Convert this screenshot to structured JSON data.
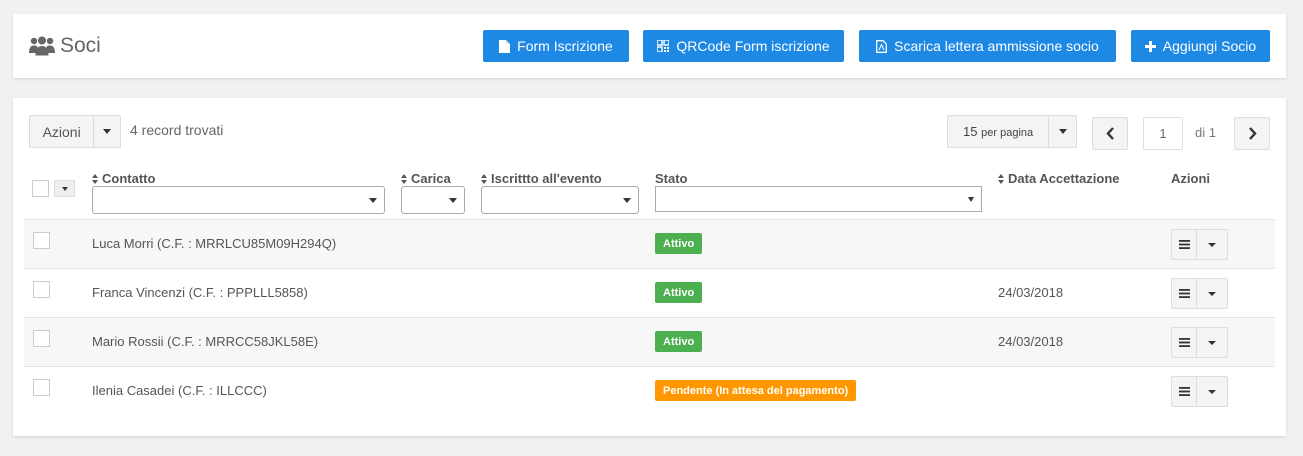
{
  "header": {
    "title": "Soci",
    "title_icon": "users-icon",
    "buttons": [
      {
        "label": "Form Iscrizione",
        "icon": "file-icon"
      },
      {
        "label": "QRCode Form iscrizione",
        "icon": "qrcode-icon"
      },
      {
        "label": "Scarica lettera ammissione socio",
        "icon": "pdf-icon"
      },
      {
        "label": "Aggiungi Socio",
        "icon": "plus-icon"
      }
    ],
    "accent_color": "#1e88e5"
  },
  "toolbar": {
    "actions_label": "Azioni",
    "record_count": "4 record trovati",
    "per_page_value": "15",
    "per_page_suffix": "per pagina",
    "current_page": "1",
    "page_of": "di 1"
  },
  "table": {
    "columns": [
      "Contatto",
      "Carica",
      "Iscrittto all'evento",
      "Stato",
      "Data Accettazione",
      "Azioni"
    ],
    "rows": [
      {
        "name": "Luca Morri (C.F. : MRRLCU85M09H294Q)",
        "status": "Attivo",
        "status_color": "#4caf50",
        "date": ""
      },
      {
        "name": "Franca Vincenzi (C.F. : PPPLLL5858)",
        "status": "Attivo",
        "status_color": "#4caf50",
        "date": "24/03/2018"
      },
      {
        "name": "Mario Rossii (C.F. : MRRCC58JKL58E)",
        "status": "Attivo",
        "status_color": "#4caf50",
        "date": "24/03/2018"
      },
      {
        "name": "Ilenia Casadei (C.F. : ILLCCC)",
        "status": "Pendente (In attesa del pagamento)",
        "status_color": "#ff9800",
        "date": ""
      }
    ]
  }
}
